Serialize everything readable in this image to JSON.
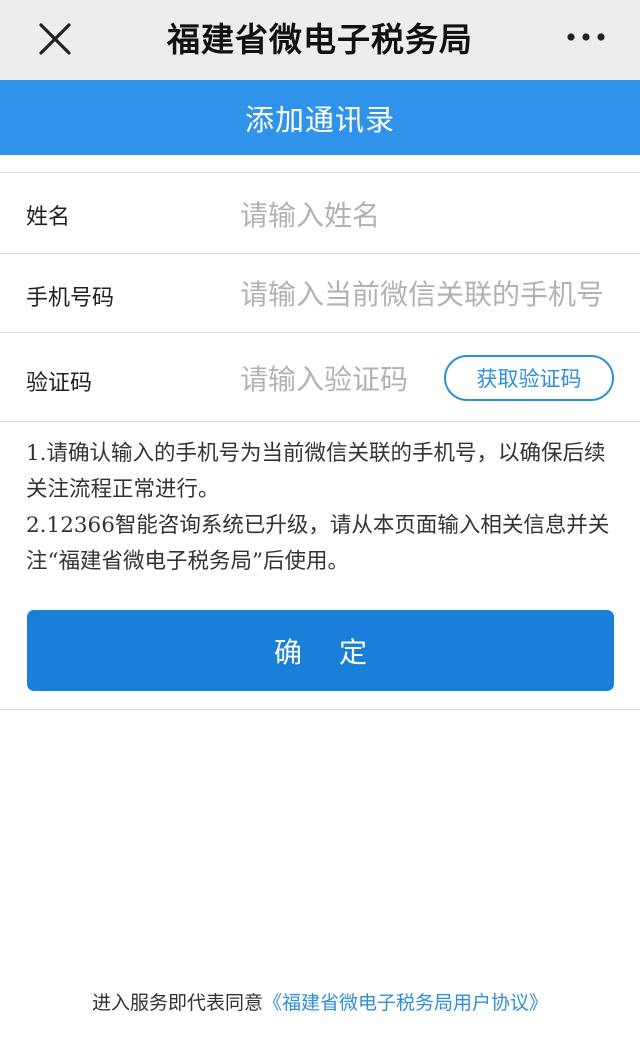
{
  "topbar": {
    "title": "福建省微电子税务局",
    "close_icon": "close-icon",
    "more_icon": "more-icon"
  },
  "header": {
    "title": "添加通讯录"
  },
  "form": {
    "name": {
      "label": "姓名",
      "placeholder": "请输入姓名",
      "value": ""
    },
    "phone": {
      "label": "手机号码",
      "placeholder": "请输入当前微信关联的手机号",
      "value": ""
    },
    "code": {
      "label": "验证码",
      "placeholder": "请输入验证码",
      "value": "",
      "button_label": "获取验证码"
    }
  },
  "notes": [
    "1.请确认输入的手机号为当前微信关联的手机号，以确保后续关注流程正常进行。",
    "2.12366智能咨询系统已升级，请从本页面输入相关信息并关注“福建省微电子税务局”后使用。"
  ],
  "confirm_label": "确 定",
  "footer": {
    "prefix": "进入服务即代表同意",
    "link": "《福建省微电子税务局用户协议》"
  },
  "colors": {
    "header_blue": "#2f93eb",
    "button_blue": "#1a7fd8",
    "link_blue": "#2e8fd9",
    "topbar_gray": "#ededed"
  }
}
